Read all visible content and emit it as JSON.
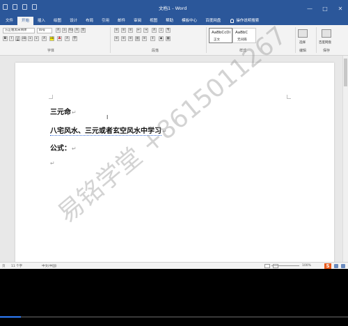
{
  "window": {
    "title": "文档1 - Word",
    "controls": [
      "—",
      "□",
      "✕"
    ]
  },
  "tabs": [
    "文件",
    "开始",
    "插入",
    "绘图",
    "设计",
    "布局",
    "引用",
    "邮件",
    "审阅",
    "视图",
    "帮助",
    "模板中心",
    "百度网盘"
  ],
  "tell_me": "操作说明搜索",
  "ribbon": {
    "font_name": "方正粗黑宋简体",
    "font_size": "四号",
    "groups": {
      "font": "字体",
      "paragraph": "段落",
      "styles": "样式",
      "editing": "编辑",
      "save": "保存"
    },
    "styles": [
      {
        "sample": "AaBbCcDi",
        "name": "正文"
      },
      {
        "sample": "AaBbC",
        "name": "无间隔"
      }
    ],
    "select_label": "选择",
    "baidu_label": "百度网盘"
  },
  "document": {
    "lines": [
      "三元命",
      "八宅风水、三元或者玄空风水中学习",
      "公式："
    ],
    "paragraph_mark": "↵"
  },
  "watermark": "易铭学堂 +8615011267",
  "statusbar": {
    "page": "页",
    "words": "11 个字",
    "language": "中文(中国)",
    "zoom": "100%"
  },
  "video": {
    "progress": 0.06
  },
  "colors": {
    "ribbon_blue": "#2b579a",
    "progress_blue": "#2f7fff"
  }
}
